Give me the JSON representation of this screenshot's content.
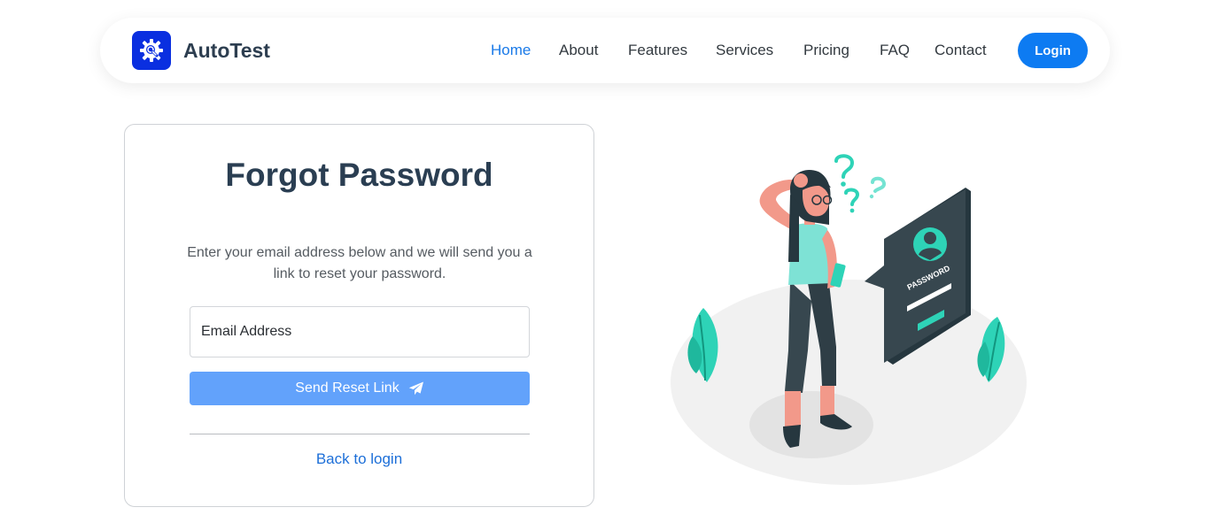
{
  "brand": {
    "name": "AutoTest",
    "logo_icon": "gear-search-icon",
    "logo_color": "#0a2fe0"
  },
  "nav": {
    "links": [
      {
        "label": "Home",
        "active": true
      },
      {
        "label": "About",
        "active": false
      },
      {
        "label": "Features",
        "active": false
      },
      {
        "label": "Services",
        "active": false
      },
      {
        "label": "Pricing",
        "active": false
      },
      {
        "label": "FAQ",
        "active": false
      },
      {
        "label": "Contact",
        "active": false
      }
    ],
    "login_label": "Login",
    "active_color": "#1a7ae8",
    "login_color": "#0d7bf2"
  },
  "form": {
    "title": "Forgot Password",
    "description": "Enter your email address below and we will send you a link to reset your password.",
    "email_placeholder": "Email Address",
    "email_value": "",
    "submit_label": "Send Reset Link",
    "submit_icon": "paper-plane-icon",
    "submit_color": "#62a2fb",
    "back_link": "Back to login"
  },
  "illustration": {
    "password_label": "PASSWORD",
    "accent_color": "#2ed3b7"
  }
}
